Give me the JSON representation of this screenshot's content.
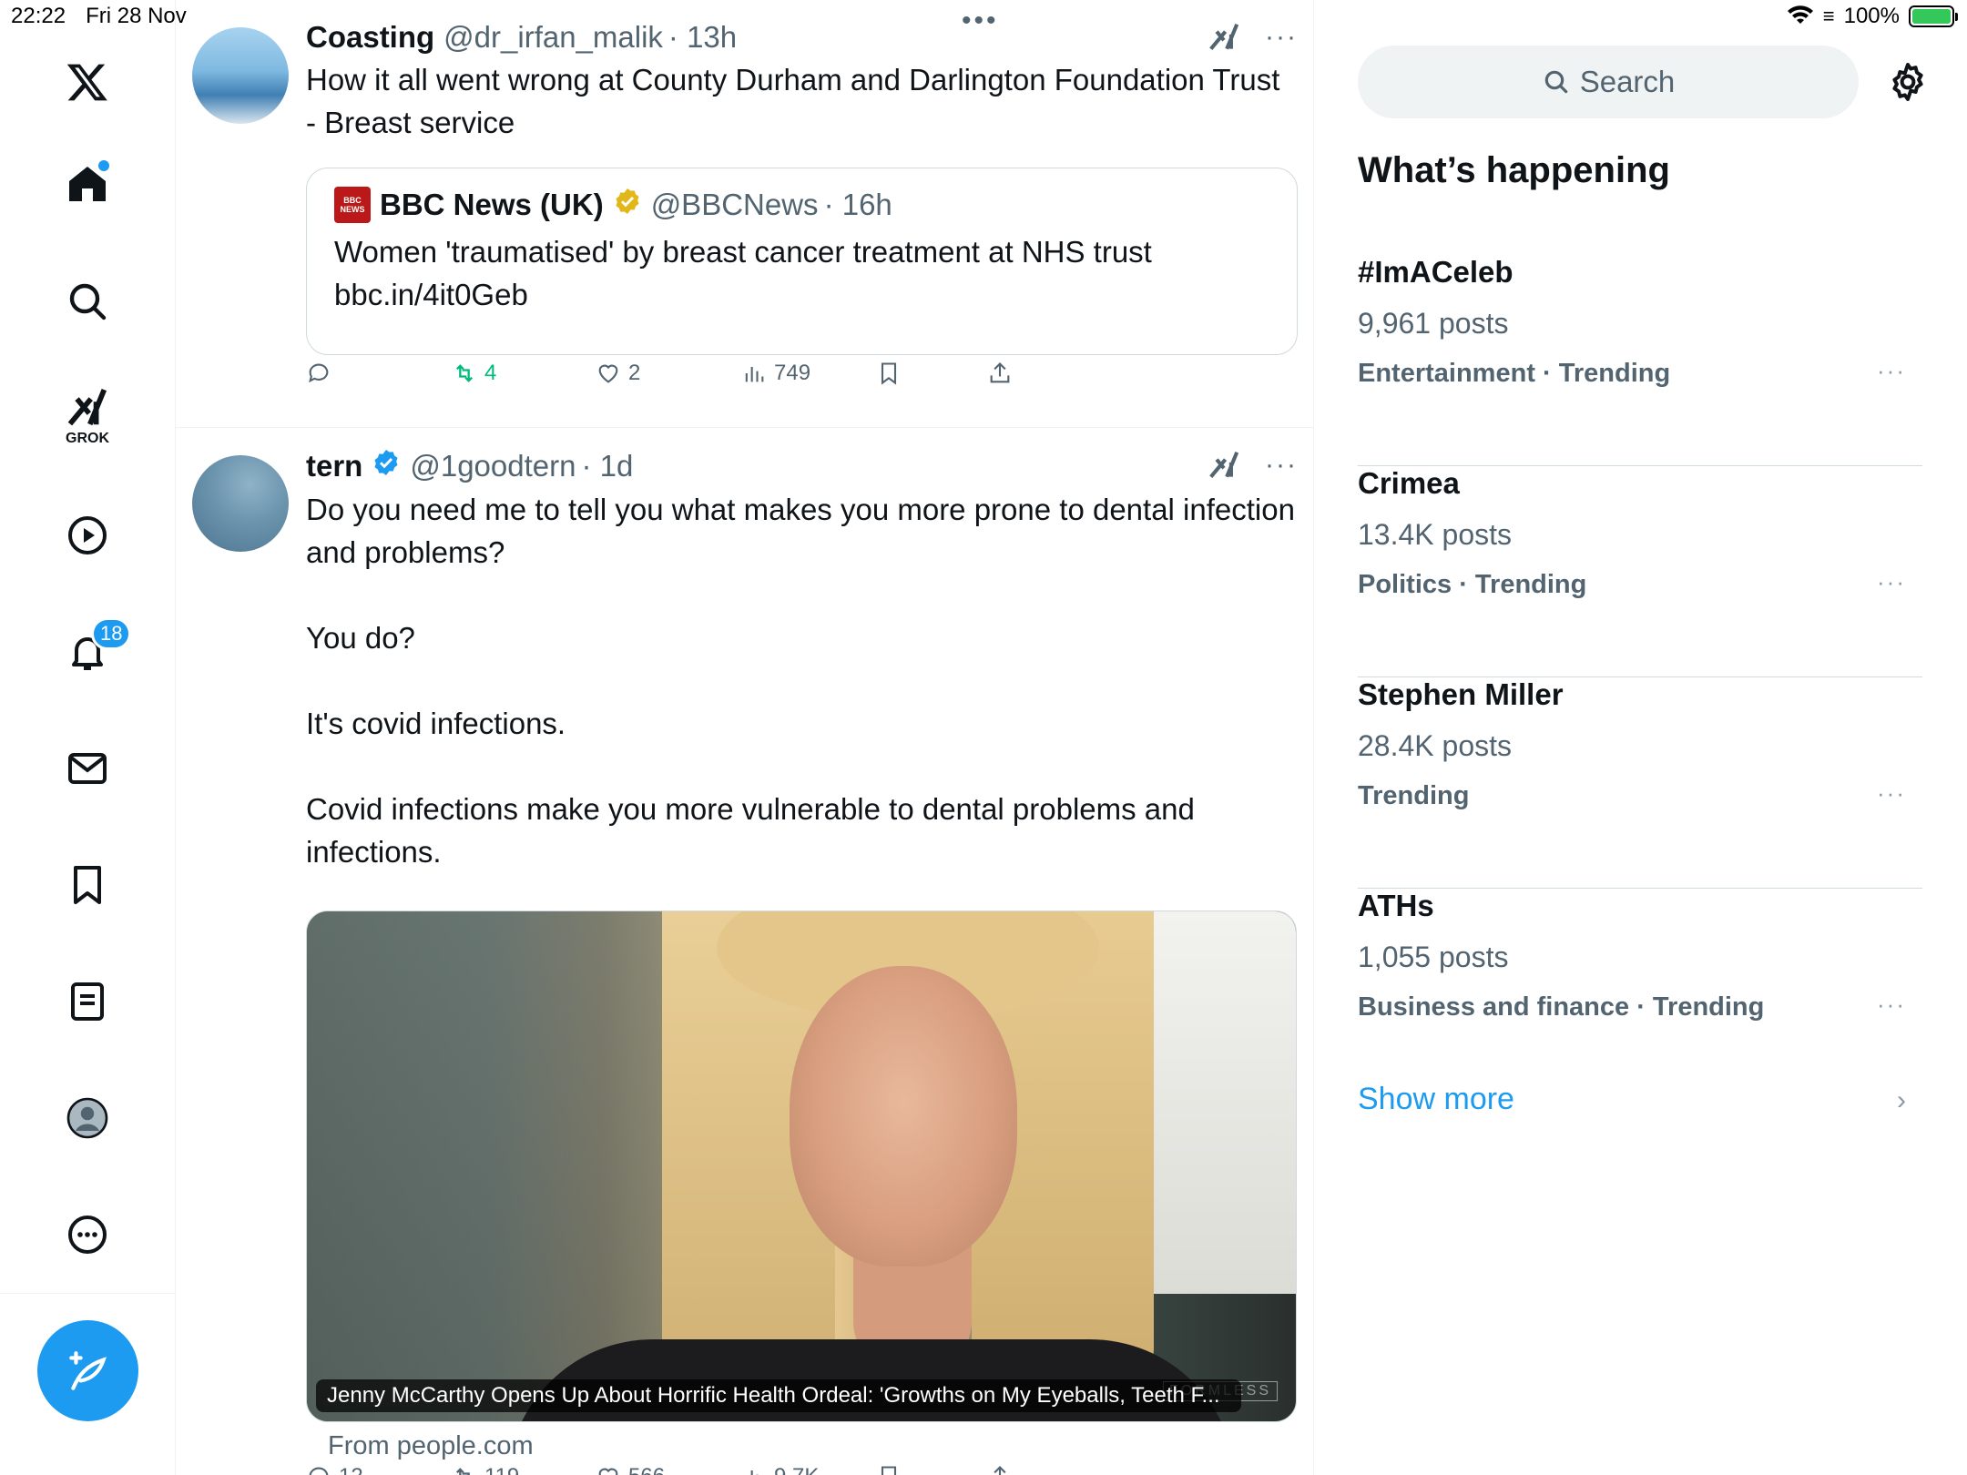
{
  "status_bar": {
    "time": "22:22",
    "date": "Fri 28 Nov",
    "battery": "100%"
  },
  "nav": {
    "notifications_badge": "18",
    "grok_label": "GROK"
  },
  "tweets": [
    {
      "name": "Coasting",
      "handle": "@dr_irfan_malik",
      "time": "· 13h",
      "text": "How it all went wrong at County Durham and Darlington Foundation Trust - Breast service",
      "quote": {
        "name": "BBC News (UK)",
        "handle": "@BBCNews",
        "time": "· 16h",
        "text": "Women 'traumatised' by breast cancer treatment at NHS trust bbc.in/4it0Geb",
        "logo_text": "BBC NEWS"
      },
      "stats": {
        "replies": "",
        "reposts": "4",
        "likes": "2",
        "views": "749"
      }
    },
    {
      "name": "tern",
      "handle": "@1goodtern",
      "time": "· 1d",
      "text": "Do you need me to tell you what makes you more prone to dental infection and problems?\n\nYou do?\n\nIt's covid infections.\n\nCovid infections make you more vulnerable to dental problems and infections.",
      "media_caption": "Jenny McCarthy Opens Up About Horrific Health Ordeal: 'Growths on My Eyeballs, Teeth F...",
      "media_watermark": "FORMLESS",
      "from": "From people.com",
      "stats": {
        "replies": "12",
        "reposts": "119",
        "likes": "566",
        "views": "9.7K"
      }
    }
  ],
  "sidebar": {
    "search_placeholder": "Search",
    "section_title": "What’s happening",
    "trends": [
      {
        "title": "#ImACeleb",
        "count": "9,961 posts",
        "category": "Entertainment · Trending"
      },
      {
        "title": "Crimea",
        "count": "13.4K posts",
        "category": "Politics · Trending"
      },
      {
        "title": "Stephen Miller",
        "count": "28.4K posts",
        "category": "Trending"
      },
      {
        "title": "ATHs",
        "count": "1,055 posts",
        "category": "Business and finance · Trending"
      }
    ],
    "show_more": "Show more"
  },
  "colors": {
    "accent": "#1d9bf0",
    "repost": "#00ba7c",
    "muted": "#536471",
    "bbc": "#bb1919"
  }
}
